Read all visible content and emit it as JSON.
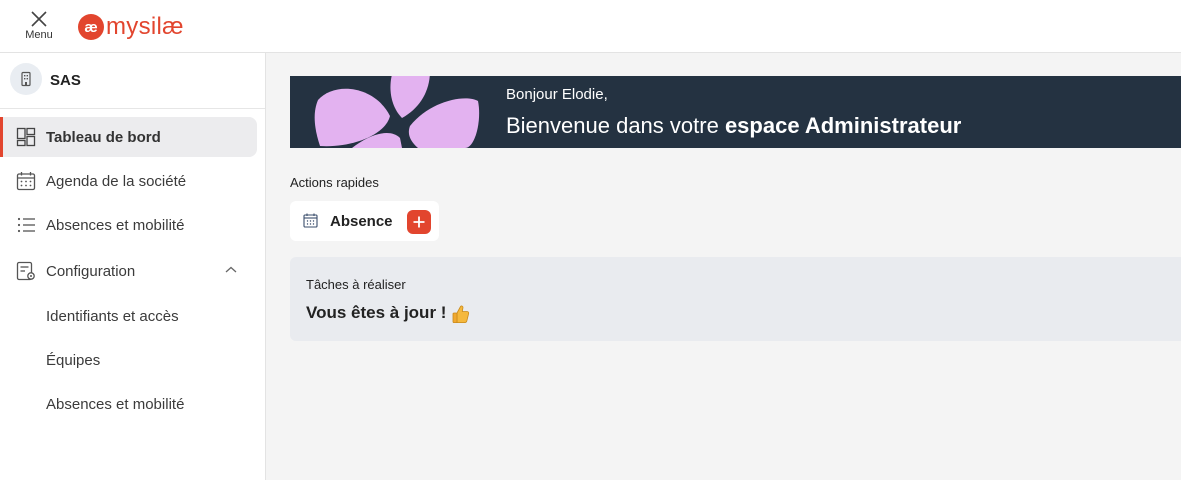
{
  "header": {
    "menu_label": "Menu",
    "logo_mark": "æ",
    "logo_text": "mysilæ",
    "icons": {
      "menu": "close-x-icon"
    }
  },
  "sidebar": {
    "company": {
      "name": "SAS",
      "icon": "building-icon"
    },
    "items": [
      {
        "label": "Tableau de bord",
        "icon": "dashboard-icon",
        "active": true
      },
      {
        "label": "Agenda de la société",
        "icon": "calendar-icon"
      },
      {
        "label": "Absences et mobilité",
        "icon": "list-icon"
      },
      {
        "label": "Configuration",
        "icon": "config-icon",
        "expanded": true
      }
    ],
    "subitems": [
      {
        "label": "Identifiants et accès"
      },
      {
        "label": "Équipes"
      },
      {
        "label": "Absences et mobilité"
      }
    ]
  },
  "banner": {
    "greeting": "Bonjour Elodie,",
    "welcome_prefix": "Bienvenue dans votre ",
    "welcome_bold": "espace Administrateur"
  },
  "quick_actions": {
    "title": "Actions rapides",
    "items": [
      {
        "label": "Absence",
        "icon": "calendar-icon",
        "action_icon": "plus-icon"
      }
    ]
  },
  "tasks": {
    "title": "Tâches à réaliser",
    "status": "Vous êtes à jour !",
    "emoji_icon": "thumbs-up-icon"
  },
  "colors": {
    "accent": "#e2452e",
    "banner_bg": "#243241",
    "petal": "#e3b2f0",
    "active_bg": "#ececee",
    "tasks_bg": "#e9ebef"
  }
}
